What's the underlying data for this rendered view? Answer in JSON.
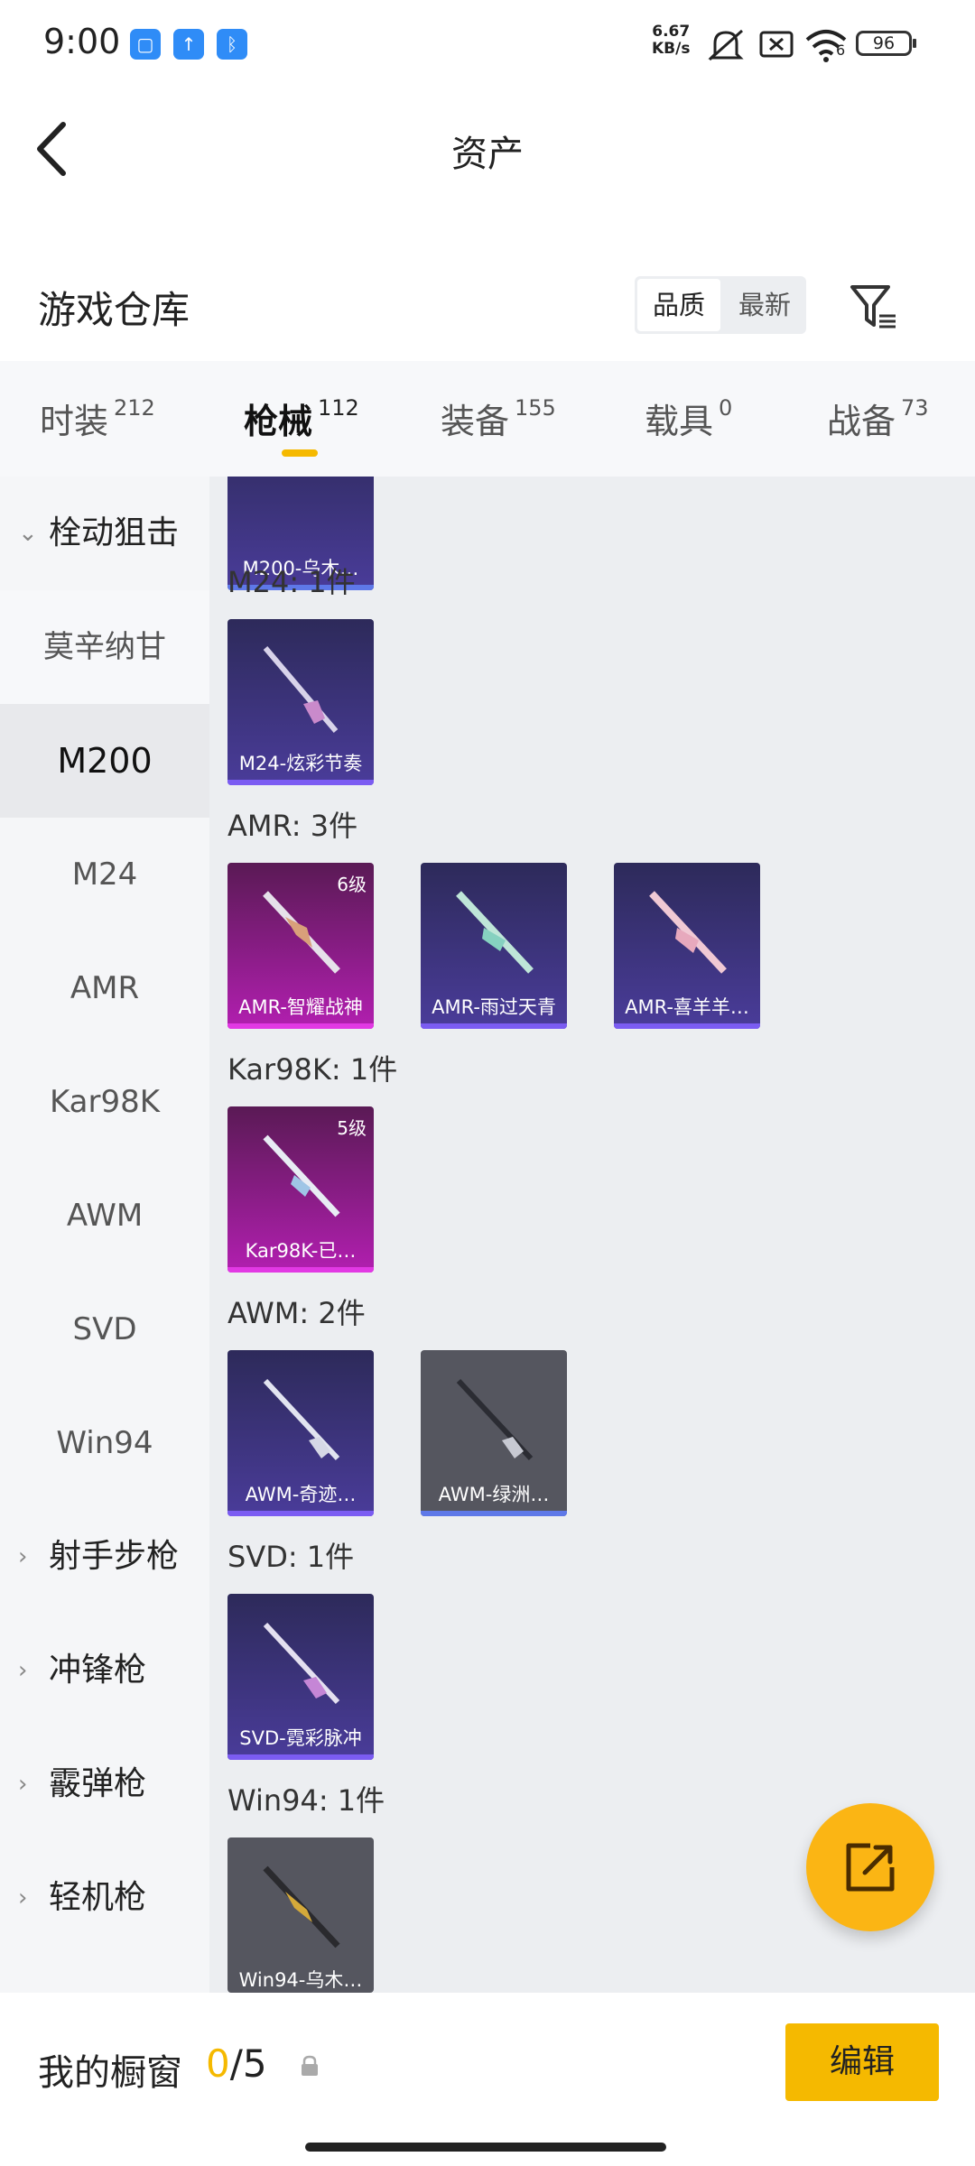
{
  "status_bar": {
    "time": "9:00",
    "net_speed_value": "6.67",
    "net_speed_unit": "KB/s",
    "battery": "96",
    "wifi_badge": "6",
    "icons": [
      "app-icon",
      "upload-icon",
      "bluetooth-icon",
      "mute-icon",
      "no-sim-icon",
      "wifi-icon",
      "battery-icon"
    ]
  },
  "header": {
    "title": "资产"
  },
  "warehouse": {
    "title": "游戏仓库",
    "sort_options": [
      "品质",
      "最新"
    ],
    "sort_selected": "品质"
  },
  "tabs": [
    {
      "label": "时装",
      "count": "212"
    },
    {
      "label": "枪械",
      "count": "112",
      "active": true
    },
    {
      "label": "装备",
      "count": "155"
    },
    {
      "label": "载具",
      "count": "0"
    },
    {
      "label": "战备",
      "count": "73"
    }
  ],
  "sidebar": {
    "items": [
      {
        "label": "栓动狙击",
        "type": "group",
        "expanded": true
      },
      {
        "label": "莫辛纳甘"
      },
      {
        "label": "M200",
        "selected": true
      },
      {
        "label": "M24"
      },
      {
        "label": "AMR"
      },
      {
        "label": "Kar98K"
      },
      {
        "label": "AWM"
      },
      {
        "label": "SVD"
      },
      {
        "label": "Win94"
      },
      {
        "label": "射手步枪",
        "type": "group"
      },
      {
        "label": "冲锋枪",
        "type": "group"
      },
      {
        "label": "霰弹枪",
        "type": "group"
      },
      {
        "label": "轻机枪",
        "type": "group"
      }
    ]
  },
  "content": {
    "top_card": {
      "name": "M200-乌木…"
    },
    "sections": [
      {
        "label": "M24: 1件",
        "cards": [
          {
            "name": "M24-炫彩节奏",
            "rarity": "purple"
          }
        ]
      },
      {
        "label": "AMR: 3件",
        "cards": [
          {
            "name": "AMR-智耀战神",
            "rarity": "gold",
            "level": "6级"
          },
          {
            "name": "AMR-雨过天青",
            "rarity": "purple"
          },
          {
            "name": "AMR-喜羊羊…",
            "rarity": "purple"
          }
        ]
      },
      {
        "label": "Kar98K: 1件",
        "cards": [
          {
            "name": "Kar98K-已…",
            "rarity": "gold",
            "level": "5级"
          }
        ]
      },
      {
        "label": "AWM: 2件",
        "cards": [
          {
            "name": "AWM-奇迹…",
            "rarity": "purple"
          },
          {
            "name": "AWM-绿洲…",
            "rarity": "grey"
          }
        ]
      },
      {
        "label": "SVD: 1件",
        "cards": [
          {
            "name": "SVD-霓彩脉冲",
            "rarity": "purple"
          }
        ]
      },
      {
        "label": "Win94: 1件",
        "cards": [
          {
            "name": "Win94-乌木…",
            "rarity": "grey"
          }
        ]
      }
    ]
  },
  "fab": {
    "icon": "share-external-icon"
  },
  "bottom_bar": {
    "label": "我的橱窗",
    "count_current": "0",
    "count_sep_total": "/5",
    "edit_label": "编辑"
  },
  "colors": {
    "accent": "#f5b900",
    "fab": "#fbb514",
    "purple_bar": "#7b5cf2",
    "gold_bar": "#e239e4"
  }
}
